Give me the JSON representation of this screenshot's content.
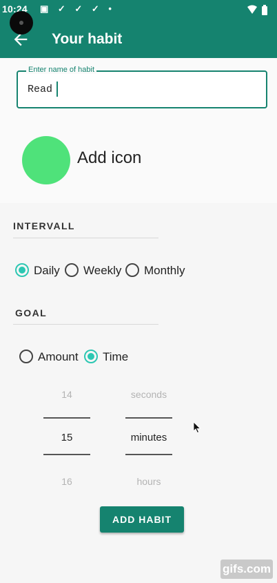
{
  "status_bar": {
    "time": "10:24",
    "icons": [
      "notification-icon",
      "check-icon",
      "check-icon",
      "check-icon",
      "dot-icon"
    ],
    "right_icons": [
      "wifi-icon",
      "battery-icon"
    ]
  },
  "app_bar": {
    "title": "Your habit",
    "back_icon": "arrow-left-icon"
  },
  "name_field": {
    "label": "Enter name of habit",
    "value": "Read"
  },
  "icon_picker": {
    "label": "Add icon",
    "color": "#4fe27a"
  },
  "interval": {
    "title": "INTERVALL",
    "options": [
      {
        "label": "Daily",
        "checked": true
      },
      {
        "label": "Weekly",
        "checked": false
      },
      {
        "label": "Monthly",
        "checked": false
      }
    ]
  },
  "goal": {
    "title": "GOAL",
    "options": [
      {
        "label": "Amount",
        "checked": false
      },
      {
        "label": "Time",
        "checked": true
      }
    ]
  },
  "number_picker": {
    "values": [
      "14",
      "15",
      "16"
    ],
    "selected": "15"
  },
  "unit_picker": {
    "values": [
      "seconds",
      "minutes",
      "hours"
    ],
    "selected": "minutes"
  },
  "add_button_label": "ADD HABIT",
  "watermark": "gifs.com",
  "colors": {
    "primary": "#15836f",
    "accent": "#2cc7b2",
    "icon_color": "#4fe27a"
  }
}
